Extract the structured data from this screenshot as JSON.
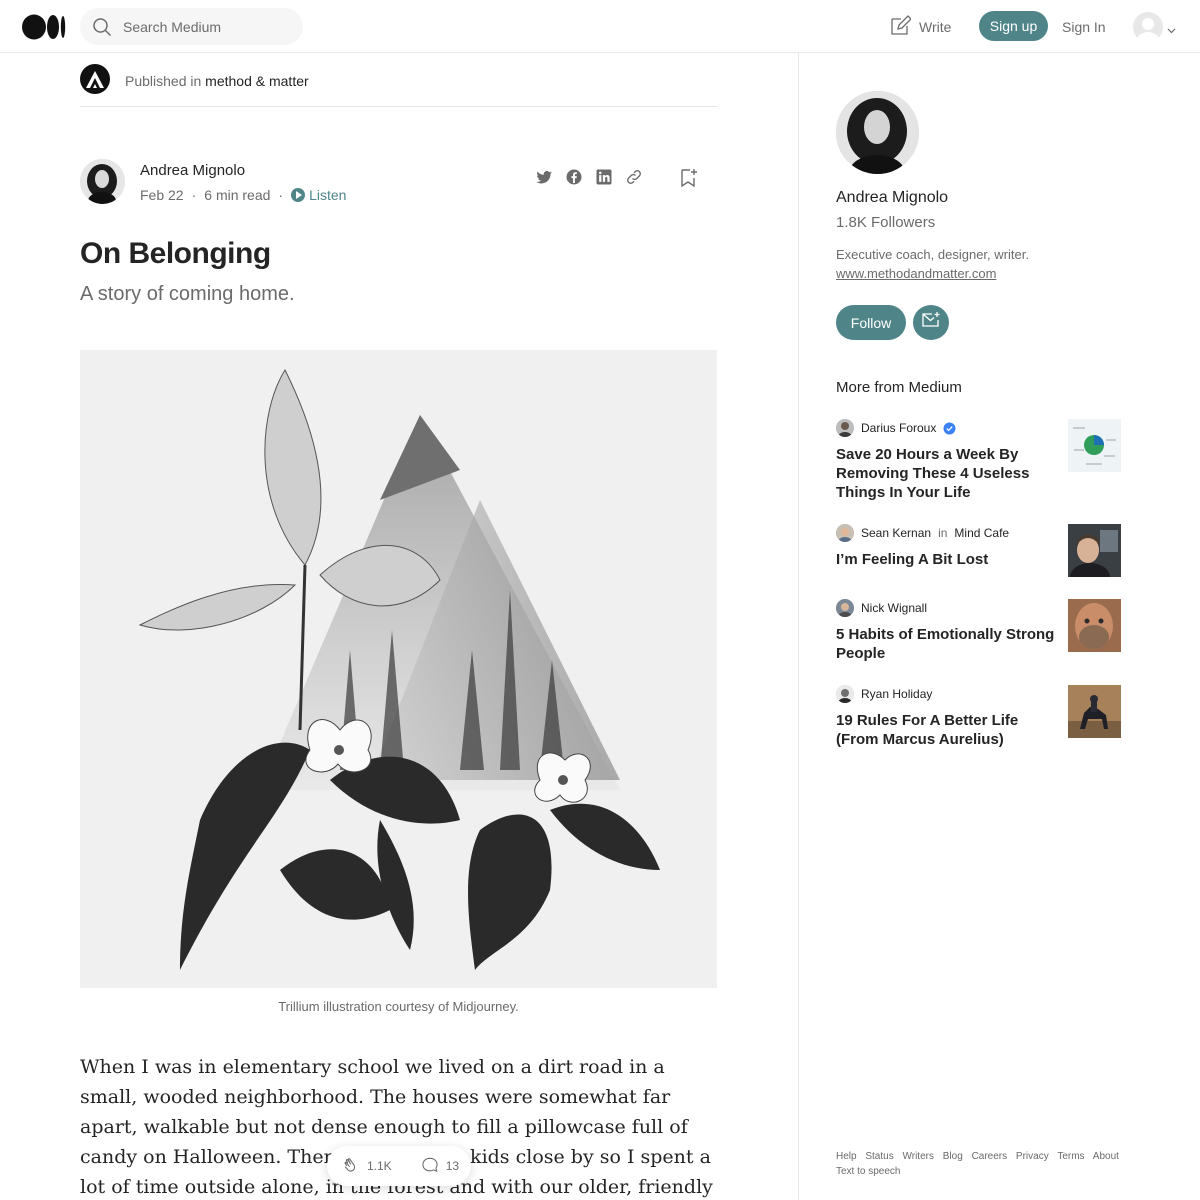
{
  "header": {
    "search_placeholder": "Search Medium",
    "write_label": "Write",
    "signup_label": "Sign up",
    "signin_label": "Sign In"
  },
  "publication": {
    "prefix": "Published in",
    "name": "method & matter"
  },
  "article": {
    "author": "Andrea Mignolo",
    "date": "Feb 22",
    "read_time": "6 min read",
    "listen_label": "Listen",
    "title": "On Belonging",
    "subtitle": "A story of coming home.",
    "image_caption": "Trillium illustration courtesy of Midjourney.",
    "body_paragraph": "When I was in elementary school we lived on a dirt road in a small, wooded neighborhood. The houses were somewhat far apart, walkable but not dense enough to fill a pillowcase full of candy on Halloween. There weren’t any kids close by so I spent a lot of time outside alone, in the forest and with our older, friendly neighbors."
  },
  "engagement": {
    "claps": "1.1K",
    "responses": "13"
  },
  "sidebar": {
    "author_name": "Andrea Mignolo",
    "followers": "1.8K Followers",
    "bio": "Executive coach, designer, writer.",
    "website": "www.methodandmatter.com",
    "follow_label": "Follow",
    "more_from_label": "More from Medium",
    "recommendations": [
      {
        "author": "Darius Foroux",
        "in_label": "",
        "publication": "",
        "verified": true,
        "title": "Save 20 Hours a Week By Removing These 4 Useless Things In Your Life"
      },
      {
        "author": "Sean Kernan",
        "in_label": "in",
        "publication": "Mind Cafe",
        "verified": false,
        "title": "I’m Feeling A Bit Lost"
      },
      {
        "author": "Nick Wignall",
        "in_label": "",
        "publication": "",
        "verified": false,
        "title": "5 Habits of Emotionally Strong People"
      },
      {
        "author": "Ryan Holiday",
        "in_label": "",
        "publication": "",
        "verified": false,
        "title": "19 Rules For A Better Life (From Marcus Aurelius)"
      }
    ]
  },
  "footer": {
    "links": [
      "Help",
      "Status",
      "Writers",
      "Blog",
      "Careers",
      "Privacy",
      "Terms",
      "About",
      "Text to speech"
    ]
  },
  "colors": {
    "accent": "#4f8589",
    "text": "#242424",
    "muted": "#6b6b6b"
  }
}
